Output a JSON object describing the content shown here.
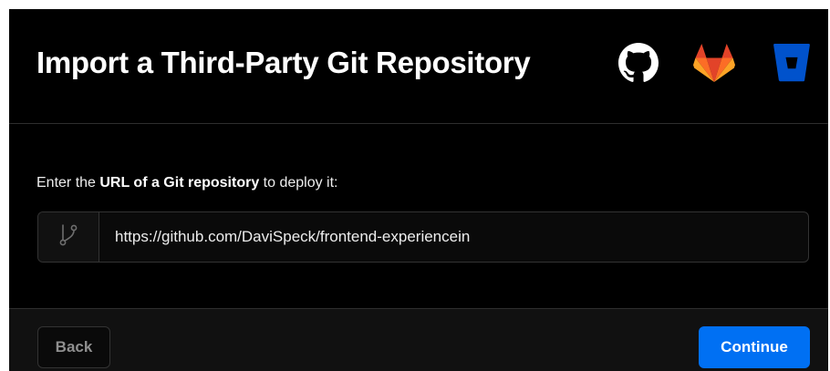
{
  "dialog": {
    "title": "Import a Third-Party Git Repository"
  },
  "providers": [
    {
      "name": "github-icon",
      "color": "#ffffff"
    },
    {
      "name": "gitlab-icon",
      "color": "#fc6d26"
    },
    {
      "name": "bitbucket-icon",
      "color": "#0052cc"
    }
  ],
  "form": {
    "instruction_prefix": "Enter the ",
    "instruction_bold": "URL of a Git repository",
    "instruction_suffix": " to deploy it:",
    "prefix_icon": "git-branch-icon",
    "url_value": "https://github.com/DaviSpeck/frontend-experiencein"
  },
  "footer": {
    "back_label": "Back",
    "continue_label": "Continue"
  },
  "colors": {
    "background": "#000000",
    "accent": "#0070f3",
    "border": "#333333"
  }
}
